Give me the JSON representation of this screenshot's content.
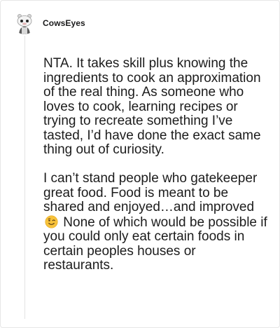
{
  "comment": {
    "author": "CowsEyes",
    "avatar_icon": "snoo-avatar-icon",
    "paragraph1": "NTA. It takes skill plus knowing the ingredients to cook an approximation of the real thing. As someone who loves to cook, learning recipes or trying to recreate something I’ve tasted, I’d have done the exact same thing out of curiosity.",
    "paragraph2_before": "I can’t stand people who gatekeeper great food. Food is meant to be shared and enjoyed…and improved",
    "paragraph2_emoji": "winking-face-emoji",
    "paragraph2_after": "None of which would be possible if you could only eat certain foods in certain peoples houses or restaurants."
  }
}
